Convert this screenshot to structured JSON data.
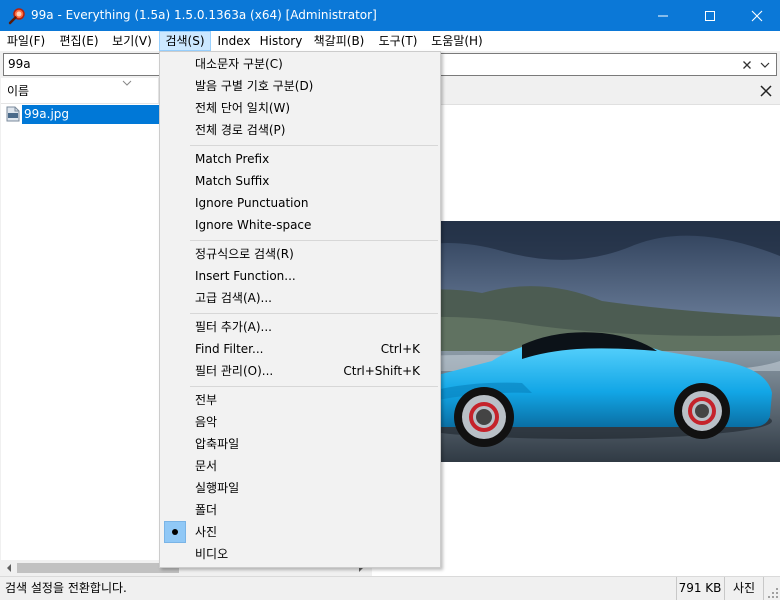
{
  "window": {
    "title": "99a - Everything (1.5a) 1.5.0.1363a (x64) [Administrator]",
    "accent_color": "#0b78d7"
  },
  "menubar": {
    "items": [
      {
        "label": "파일(F)"
      },
      {
        "label": "편집(E)"
      },
      {
        "label": "보기(V)"
      },
      {
        "label": "검색(S)"
      },
      {
        "label": "Index"
      },
      {
        "label": "History"
      },
      {
        "label": "책갈피(B)"
      },
      {
        "label": "도구(T)"
      },
      {
        "label": "도움말(H)"
      }
    ],
    "open_index": 3
  },
  "search": {
    "value": "99a"
  },
  "file_list": {
    "column_header": "이름",
    "rows": [
      {
        "name": "99a.jpg",
        "icon": "jpg-file-icon"
      }
    ]
  },
  "status": {
    "text": "검색 설정을 전환합니다.",
    "size": "791 KB",
    "type": "사진"
  },
  "search_menu": {
    "group1": [
      {
        "label": "대소문자 구분(C)"
      },
      {
        "label": "발음 구별 기호 구분(D)"
      },
      {
        "label": "전체 단어 일치(W)"
      },
      {
        "label": "전체 경로 검색(P)"
      }
    ],
    "group2": [
      {
        "label": "Match Prefix"
      },
      {
        "label": "Match Suffix"
      },
      {
        "label": "Ignore Punctuation"
      },
      {
        "label": "Ignore White-space"
      }
    ],
    "group3": [
      {
        "label": "정규식으로 검색(R)"
      },
      {
        "label": "Insert Function..."
      },
      {
        "label": "고급 검색(A)..."
      }
    ],
    "group4": [
      {
        "label": "필터 추가(A)...",
        "accel": ""
      },
      {
        "label": "Find Filter...",
        "accel": "Ctrl+K"
      },
      {
        "label": "필터 관리(O)...",
        "accel": "Ctrl+Shift+K"
      }
    ],
    "group5": [
      {
        "label": "전부"
      },
      {
        "label": "음악"
      },
      {
        "label": "압축파일"
      },
      {
        "label": "문서"
      },
      {
        "label": "실행파일"
      },
      {
        "label": "폴더"
      },
      {
        "label": "사진",
        "checked": true
      },
      {
        "label": "비디오"
      }
    ]
  }
}
